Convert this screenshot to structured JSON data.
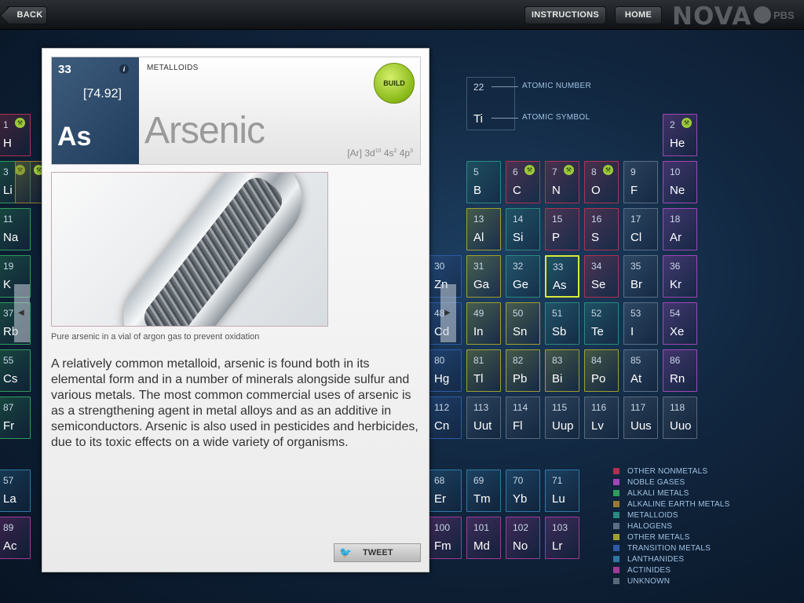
{
  "topbar": {
    "back": "BACK",
    "instructions": "INSTRUCTIONS",
    "home": "HOME",
    "brand": "NOVA",
    "pbs": "PBS"
  },
  "key": {
    "number": "22",
    "symbol": "Ti",
    "number_label": "ATOMIC NUMBER",
    "symbol_label": "ATOMIC SYMBOL"
  },
  "legend": [
    {
      "label": "OTHER NONMETALS",
      "color": "#b03050"
    },
    {
      "label": "NOBLE GASES",
      "color": "#a046b8"
    },
    {
      "label": "ALKALI METALS",
      "color": "#2f9c5c"
    },
    {
      "label": "ALKALINE EARTH METALS",
      "color": "#9a7a30"
    },
    {
      "label": "METALLOIDS",
      "color": "#2a8a80"
    },
    {
      "label": "HALOGENS",
      "color": "#5a6e86"
    },
    {
      "label": "OTHER METALS",
      "color": "#a0a030"
    },
    {
      "label": "TRANSITION METALS",
      "color": "#2e5aa6"
    },
    {
      "label": "LANTHANIDES",
      "color": "#2f78a4"
    },
    {
      "label": "ACTINIDES",
      "color": "#a03a9a"
    },
    {
      "label": "UNKNOWN",
      "color": "#5a6a7a"
    }
  ],
  "cells": [
    {
      "n": "1",
      "s": "H",
      "b": true,
      "c": "#b03050"
    },
    {
      "n": "2",
      "s": "He",
      "b": true,
      "c": "#a046b8"
    },
    {
      "n": "3",
      "s": "Li",
      "b": true,
      "c": "#2f9c5c"
    },
    {
      "n": "",
      "s": "",
      "b": true,
      "c": "#9a7a30"
    },
    {
      "n": "5",
      "s": "B",
      "b": false,
      "c": "#2a8a80"
    },
    {
      "n": "6",
      "s": "C",
      "b": true,
      "c": "#b03050"
    },
    {
      "n": "7",
      "s": "N",
      "b": true,
      "c": "#b03050"
    },
    {
      "n": "8",
      "s": "O",
      "b": true,
      "c": "#b03050"
    },
    {
      "n": "9",
      "s": "F",
      "b": false,
      "c": "#5a6e86"
    },
    {
      "n": "10",
      "s": "Ne",
      "b": false,
      "c": "#a046b8"
    },
    {
      "n": "11",
      "s": "Na",
      "b": false,
      "c": "#2f9c5c"
    },
    {
      "n": "13",
      "s": "Al",
      "b": false,
      "c": "#a0a030"
    },
    {
      "n": "14",
      "s": "Si",
      "b": false,
      "c": "#2a8a80"
    },
    {
      "n": "15",
      "s": "P",
      "b": false,
      "c": "#b03050"
    },
    {
      "n": "16",
      "s": "S",
      "b": false,
      "c": "#b03050"
    },
    {
      "n": "17",
      "s": "Cl",
      "b": false,
      "c": "#5a6e86"
    },
    {
      "n": "18",
      "s": "Ar",
      "b": false,
      "c": "#a046b8"
    },
    {
      "n": "19",
      "s": "K",
      "b": false,
      "c": "#2f9c5c"
    },
    {
      "n": "30",
      "s": "Zn",
      "b": false,
      "c": "#2e5aa6"
    },
    {
      "n": "31",
      "s": "Ga",
      "b": false,
      "c": "#a0a030"
    },
    {
      "n": "32",
      "s": "Ge",
      "b": false,
      "c": "#2a8a80"
    },
    {
      "n": "33",
      "s": "As",
      "b": false,
      "c": "#2a8a80",
      "sel": true
    },
    {
      "n": "34",
      "s": "Se",
      "b": false,
      "c": "#b03050"
    },
    {
      "n": "35",
      "s": "Br",
      "b": false,
      "c": "#5a6e86"
    },
    {
      "n": "36",
      "s": "Kr",
      "b": false,
      "c": "#a046b8"
    },
    {
      "n": "37",
      "s": "Rb",
      "b": false,
      "c": "#2f9c5c"
    },
    {
      "n": "48",
      "s": "Cd",
      "b": false,
      "c": "#2e5aa6"
    },
    {
      "n": "49",
      "s": "In",
      "b": false,
      "c": "#a0a030"
    },
    {
      "n": "50",
      "s": "Sn",
      "b": false,
      "c": "#a0a030"
    },
    {
      "n": "51",
      "s": "Sb",
      "b": false,
      "c": "#2a8a80"
    },
    {
      "n": "52",
      "s": "Te",
      "b": false,
      "c": "#2a8a80"
    },
    {
      "n": "53",
      "s": "I",
      "b": false,
      "c": "#5a6e86"
    },
    {
      "n": "54",
      "s": "Xe",
      "b": false,
      "c": "#a046b8"
    },
    {
      "n": "55",
      "s": "Cs",
      "b": false,
      "c": "#2f9c5c"
    },
    {
      "n": "80",
      "s": "Hg",
      "b": false,
      "c": "#2e5aa6"
    },
    {
      "n": "81",
      "s": "Tl",
      "b": false,
      "c": "#a0a030"
    },
    {
      "n": "82",
      "s": "Pb",
      "b": false,
      "c": "#a0a030"
    },
    {
      "n": "83",
      "s": "Bi",
      "b": false,
      "c": "#a0a030"
    },
    {
      "n": "84",
      "s": "Po",
      "b": false,
      "c": "#a0a030"
    },
    {
      "n": "85",
      "s": "At",
      "b": false,
      "c": "#5a6e86"
    },
    {
      "n": "86",
      "s": "Rn",
      "b": false,
      "c": "#a046b8"
    },
    {
      "n": "87",
      "s": "Fr",
      "b": false,
      "c": "#2f9c5c"
    },
    {
      "n": "112",
      "s": "Cn",
      "b": false,
      "c": "#2e5aa6"
    },
    {
      "n": "113",
      "s": "Uut",
      "b": false,
      "c": "#5a6a7a"
    },
    {
      "n": "114",
      "s": "Fl",
      "b": false,
      "c": "#5a6a7a"
    },
    {
      "n": "115",
      "s": "Uup",
      "b": false,
      "c": "#5a6a7a"
    },
    {
      "n": "116",
      "s": "Lv",
      "b": false,
      "c": "#5a6a7a"
    },
    {
      "n": "117",
      "s": "Uus",
      "b": false,
      "c": "#5a6a7a"
    },
    {
      "n": "118",
      "s": "Uuo",
      "b": false,
      "c": "#5a6a7a"
    },
    {
      "n": "57",
      "s": "La",
      "b": false,
      "c": "#2f78a4"
    },
    {
      "n": "68",
      "s": "Er",
      "b": false,
      "c": "#2f78a4"
    },
    {
      "n": "69",
      "s": "Tm",
      "b": false,
      "c": "#2f78a4"
    },
    {
      "n": "70",
      "s": "Yb",
      "b": false,
      "c": "#2f78a4"
    },
    {
      "n": "71",
      "s": "Lu",
      "b": false,
      "c": "#2f78a4"
    },
    {
      "n": "89",
      "s": "Ac",
      "b": false,
      "c": "#a03a9a"
    },
    {
      "n": "100",
      "s": "Fm",
      "b": false,
      "c": "#a03a9a"
    },
    {
      "n": "101",
      "s": "Md",
      "b": false,
      "c": "#a03a9a"
    },
    {
      "n": "102",
      "s": "No",
      "b": false,
      "c": "#a03a9a"
    },
    {
      "n": "103",
      "s": "Lr",
      "b": false,
      "c": "#a03a9a"
    }
  ],
  "element": {
    "number": "33",
    "mass": "[74.92]",
    "symbol": "As",
    "category": "METALLOIDS",
    "name": "Arsenic",
    "config_base": "[Ar] 3d",
    "config_e1": "10",
    "config_mid1": " 4s",
    "config_e2": "2",
    "config_mid2": " 4p",
    "config_e3": "3",
    "build": "BUILD",
    "info": "i",
    "caption": "Pure arsenic in a vial of argon gas to prevent oxidation",
    "description": "A relatively common metalloid, arsenic is found both in its elemental form and in a number of minerals alongside sulfur and various metals. The most common commercial uses of arsenic is as a strengthening agent in metal alloys and as an additive in semiconductors. Arsenic is also used in pesticides and herbicides, due to its toxic effects on a wide variety of organisms.",
    "tweet": "TWEET"
  }
}
